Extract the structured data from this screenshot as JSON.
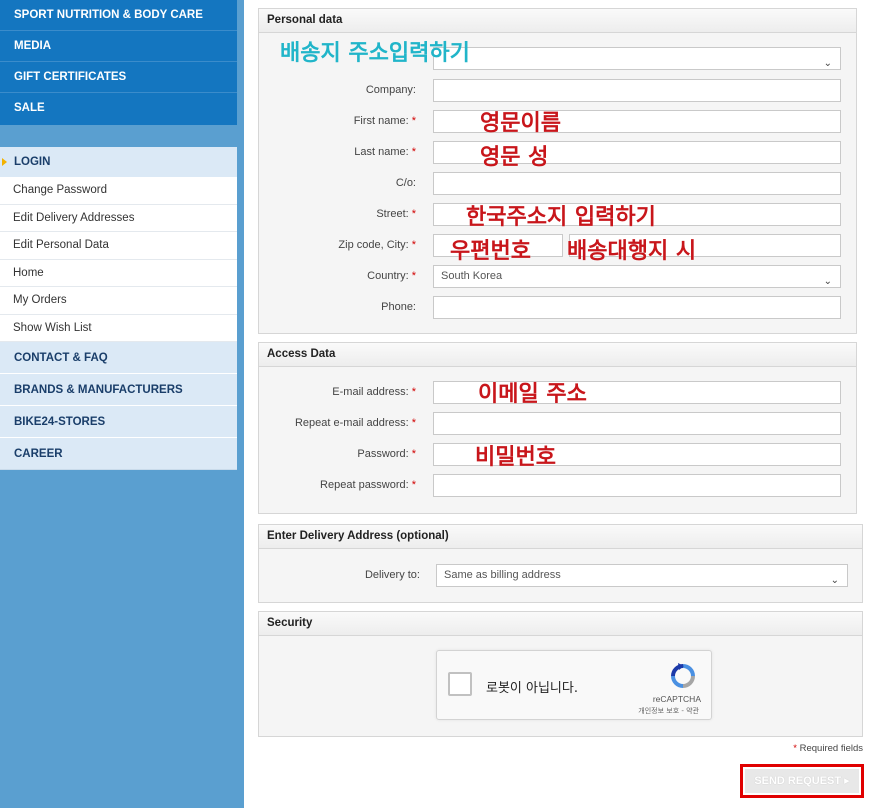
{
  "sidebar": {
    "top_items": [
      "SPORT NUTRITION & BODY CARE",
      "MEDIA",
      "GIFT CERTIFICATES",
      "SALE"
    ],
    "login_label": "LOGIN",
    "sub_items": [
      "Change Password",
      "Edit Delivery Addresses",
      "Edit Personal Data",
      "Home",
      "My Orders",
      "Show Wish List"
    ],
    "bottom_items": [
      "CONTACT & FAQ",
      "BRANDS & MANUFACTURERS",
      "BIKE24-STORES",
      "CAREER"
    ]
  },
  "personal": {
    "title": "Personal data",
    "fields": {
      "company": "Company:",
      "first_name": "First name:",
      "last_name": "Last name:",
      "co": "C/o:",
      "street": "Street:",
      "zip_city": "Zip code, City:",
      "country": "Country:",
      "phone": "Phone:"
    },
    "country_value": "South Korea"
  },
  "access": {
    "title": "Access Data",
    "fields": {
      "email": "E-mail address:",
      "repeat_email": "Repeat e-mail address:",
      "password": "Password:",
      "repeat_password": "Repeat password:"
    }
  },
  "delivery": {
    "title": "Enter Delivery Address (optional)",
    "label": "Delivery to:",
    "value": "Same as billing address"
  },
  "security": {
    "title": "Security",
    "captcha_text": "로봇이 아닙니다.",
    "captcha_brand": "reCAPTCHA",
    "captcha_links": "개인정보 보호 - 약관"
  },
  "required_mark": "*",
  "required_note": "Required fields",
  "send_label": "SEND REQUEST",
  "annotations": {
    "address_entry": "배송지 주소입력하기",
    "english_name": "영문이름",
    "english_surname": "영문 성",
    "korean_address": "한국주소지 입력하기",
    "zip": "우편번호",
    "forwarder": "배송대행지 시",
    "email": "이메일 주소",
    "password": "비밀번호"
  },
  "colors": {
    "nav_dark": "#1476c0",
    "nav_light": "#dbe9f6",
    "sidebar_bg": "#5a9fd0",
    "annotation_red": "#c8161b",
    "annotation_cyan": "#21b5c9",
    "highlight_border": "#e00000"
  }
}
